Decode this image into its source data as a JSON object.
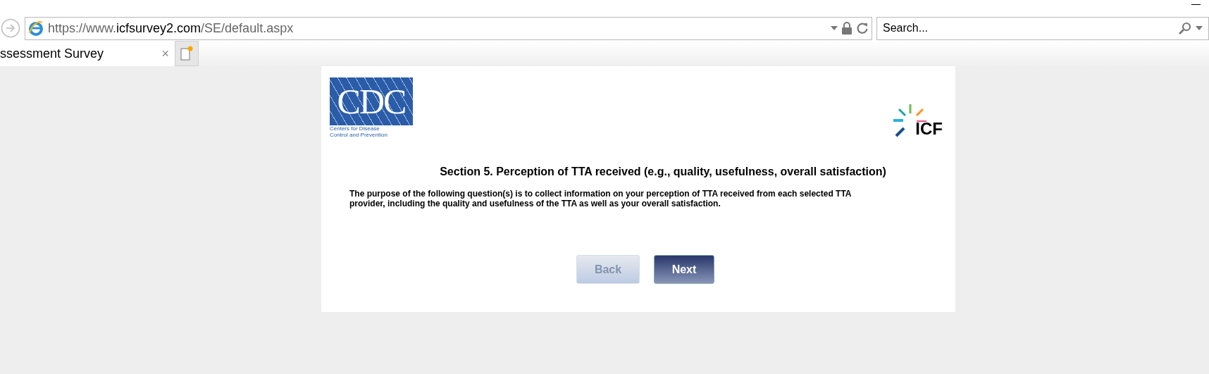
{
  "browser": {
    "address": {
      "host_prefix": "https://www.",
      "host": "icfsurvey2.com",
      "path": "/SE/default.aspx"
    },
    "search": {
      "placeholder": "Search..."
    },
    "tab": {
      "title": "ssessment Survey",
      "close": "×"
    }
  },
  "page": {
    "cdc_logo": {
      "mark": "CDC",
      "line_1": "Centers for Disease",
      "line_2": "Control and Prevention"
    },
    "icf_logo": {
      "mark": "ICF"
    },
    "heading": "Section 5. Perception of TTA received (e.g., quality, usefulness, overall satisfaction)",
    "intro": "The purpose of the following question(s) is to collect information on your perception of TTA received from each selected TTA provider, including the quality and usefulness of the TTA as well as your overall satisfaction.",
    "buttons": [
      {
        "label": "Back",
        "disabled": true
      },
      {
        "label": "Next",
        "disabled": false
      }
    ]
  }
}
